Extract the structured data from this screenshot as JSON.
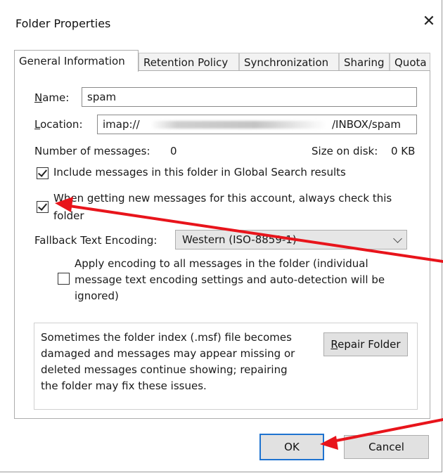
{
  "window": {
    "title": "Folder Properties",
    "close_glyph": "✕"
  },
  "tabs": [
    {
      "label": "General Information",
      "active": true
    },
    {
      "label": "Retention Policy",
      "active": false
    },
    {
      "label": "Synchronization",
      "active": false
    },
    {
      "label": "Sharing",
      "active": false
    },
    {
      "label": "Quota",
      "active": false
    }
  ],
  "general": {
    "name_label": "Name:",
    "name_value": "spam",
    "location_label": "Location:",
    "location_prefix": "imap://",
    "location_suffix": "/INBOX/spam",
    "messages_label": "Number of messages:",
    "messages_value": "0",
    "size_label": "Size on disk:",
    "size_value": "0 KB",
    "global_search": {
      "label": "Include messages in this folder in Global Search results",
      "checked": true
    },
    "check_new": {
      "label_line1": "When getting new messages for this account, always check this",
      "label_line2": "folder",
      "checked": true
    },
    "encoding_label": "Fallback Text Encoding:",
    "encoding_value": "Western (ISO-8859-1)",
    "apply_encoding": {
      "line1": "Apply encoding to all messages in the folder (individual",
      "line2": "message text encoding settings and auto-detection will be",
      "line3": "ignored)",
      "checked": false
    },
    "repair": {
      "line1": "Sometimes the folder index (.msf) file becomes",
      "line2": "damaged and messages may appear missing or",
      "line3": "deleted messages continue showing; repairing",
      "line4": "the folder may fix these issues.",
      "button_label": "Repair Folder"
    }
  },
  "footer": {
    "ok_label": "OK",
    "cancel_label": "Cancel"
  },
  "annotation": {
    "arrow_color": "#e8141b"
  },
  "icons": {
    "close": "close-icon",
    "dropdown": "chevron-down-icon",
    "check": "checkmark-icon"
  }
}
